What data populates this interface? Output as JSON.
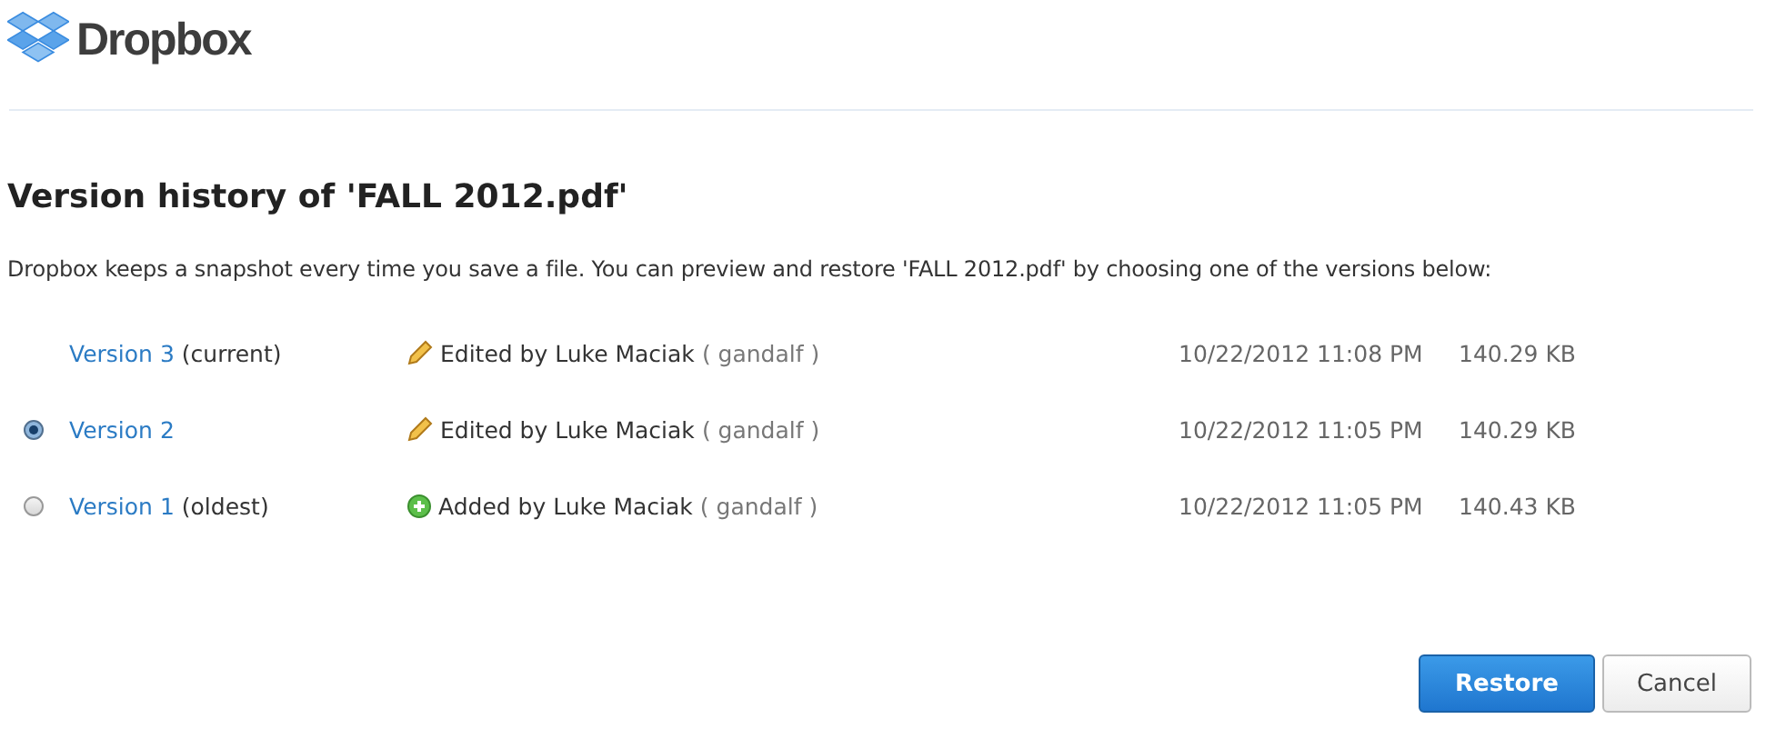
{
  "logo": {
    "text": "Dropbox"
  },
  "title": "Version history of 'FALL 2012.pdf'",
  "description": "Dropbox keeps a snapshot every time you save a file. You can preview and restore 'FALL 2012.pdf' by choosing one of the versions below:",
  "versions": [
    {
      "kind": "edited",
      "link": "Version 3",
      "note": "(current)",
      "editor": "Edited by Luke Maciak",
      "user": "( gandalf )",
      "date": "10/22/2012 11:08 PM",
      "size": "140.29 KB"
    },
    {
      "kind": "edited",
      "selected": true,
      "link": "Version 2",
      "editor": "Edited by Luke Maciak",
      "user": "( gandalf )",
      "date": "10/22/2012 11:05 PM",
      "size": "140.29 KB"
    },
    {
      "kind": "added",
      "selected": false,
      "link": "Version 1",
      "note": "(oldest)",
      "editor": "Added by Luke Maciak",
      "user": "( gandalf )",
      "date": "10/22/2012 11:05 PM",
      "size": "140.43 KB"
    }
  ],
  "buttons": [
    {
      "kind": "primary",
      "label": "Restore"
    },
    {
      "kind": "secondary",
      "label": "Cancel"
    }
  ]
}
